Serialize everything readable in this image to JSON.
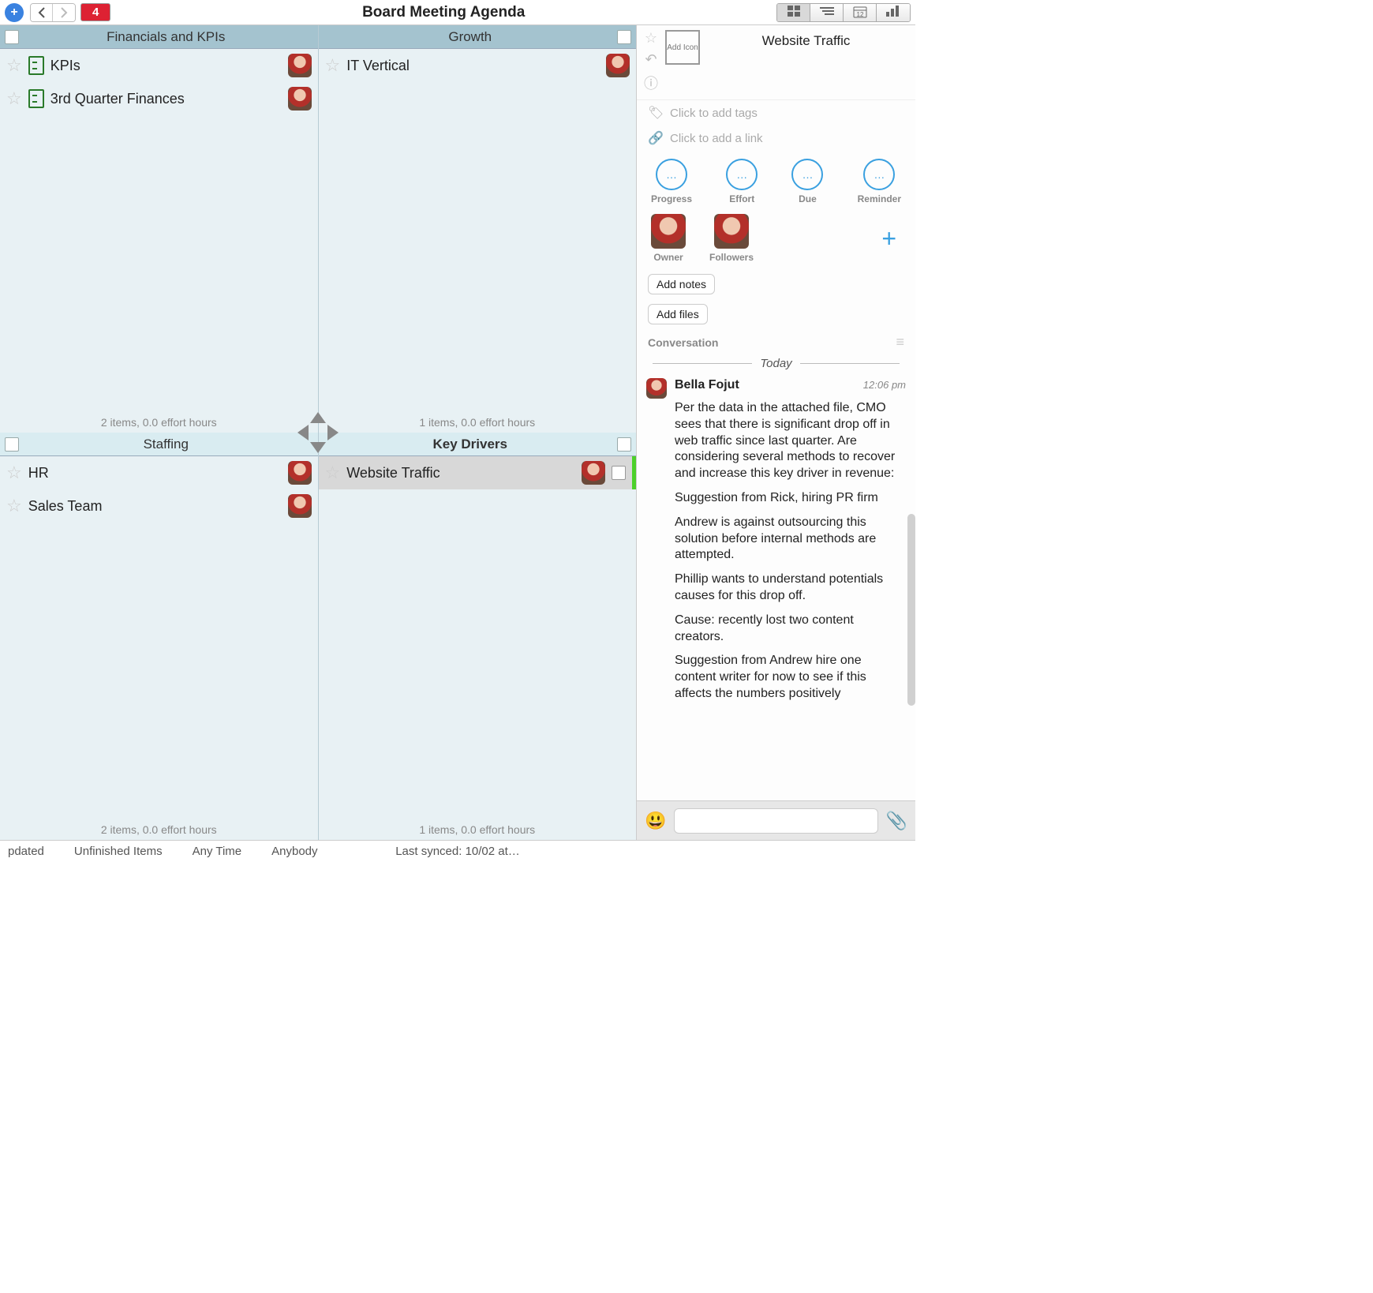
{
  "toolbar": {
    "badge": "4",
    "title": "Board Meeting Agenda"
  },
  "board": {
    "quadrants": [
      {
        "title": "Financials and KPIs",
        "footer": "2 items, 0.0 effort hours",
        "cards": [
          {
            "title": "KPIs",
            "status": true
          },
          {
            "title": "3rd Quarter Finances",
            "status": true
          }
        ]
      },
      {
        "title": "Growth",
        "footer": "1 items, 0.0 effort hours",
        "cards": [
          {
            "title": "IT Vertical",
            "status": false
          }
        ]
      },
      {
        "title": "Staffing",
        "footer": "2 items, 0.0 effort hours",
        "cards": [
          {
            "title": "HR",
            "status": false
          },
          {
            "title": "Sales Team",
            "status": false
          }
        ]
      },
      {
        "title": "Key Drivers",
        "footer": "1 items, 0.0 effort hours",
        "cards": [
          {
            "title": "Website Traffic",
            "status": false,
            "selected": true
          }
        ]
      }
    ]
  },
  "inspector": {
    "title": "Website Traffic",
    "add_icon_label": "Add Icon",
    "tags_placeholder": "Click to add tags",
    "link_placeholder": "Click to add a link",
    "stats": {
      "progress": "Progress",
      "effort": "Effort",
      "due": "Due",
      "reminder": "Reminder"
    },
    "people": {
      "owner": "Owner",
      "followers": "Followers"
    },
    "add_notes": "Add notes",
    "add_files": "Add files",
    "conversation_label": "Conversation",
    "today_label": "Today",
    "comment": {
      "author": "Bella Fojut",
      "time": "12:06 pm",
      "p1": "Per the data in the attached file, CMO sees that there is significant drop off in web traffic since last quarter. Are considering several methods to recover and increase this key driver in revenue:",
      "p2": "Suggestion from Rick, hiring PR firm",
      "p3": "Andrew is against outsourcing this solution before internal methods are attempted.",
      "p4": "Phillip wants to understand potentials causes for this drop off.",
      "p5": "Cause: recently lost two content creators.",
      "p6": "Suggestion from Andrew hire one content writer for now to see if this affects the numbers positively"
    }
  },
  "bottom": {
    "b1": "pdated",
    "b2": "Unfinished Items",
    "b3": "Any Time",
    "b4": "Anybody",
    "sync": "Last synced: 10/02 at…"
  }
}
